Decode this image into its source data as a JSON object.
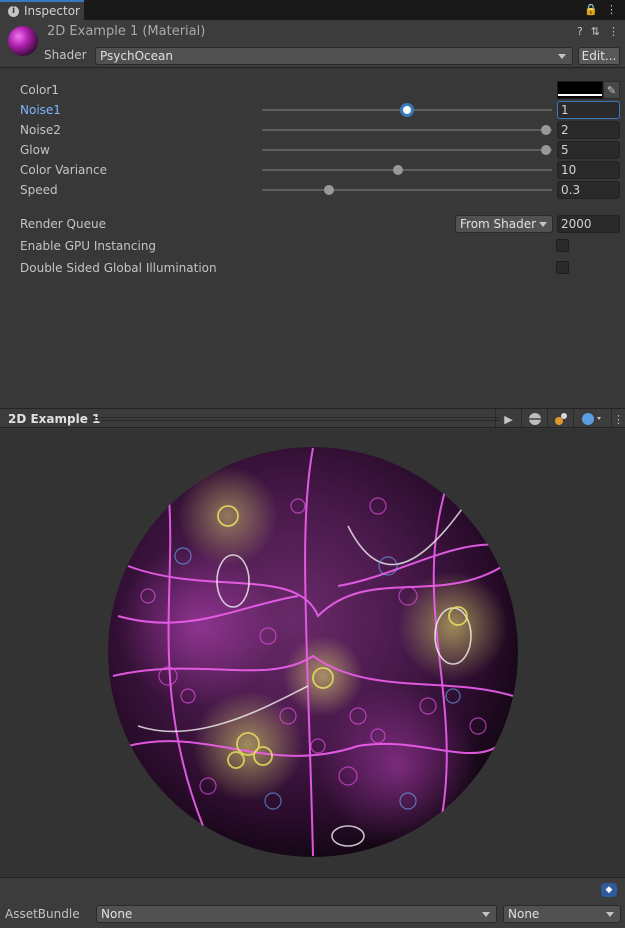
{
  "tab": {
    "label": "Inspector",
    "icon": "info-icon"
  },
  "header": {
    "title": "2D Example 1 (Material)",
    "shader_label": "Shader",
    "shader_value": "PsychOcean",
    "edit_label": "Edit..."
  },
  "properties": {
    "color1": {
      "label": "Color1",
      "color": "#000000"
    },
    "sliders": [
      {
        "label": "Noise1",
        "value": "1",
        "fraction": 0.5,
        "active": true
      },
      {
        "label": "Noise2",
        "value": "2",
        "fraction": 0.98,
        "active": false
      },
      {
        "label": "Glow",
        "value": "5",
        "fraction": 0.98,
        "active": false
      },
      {
        "label": "Color Variance",
        "value": "10",
        "fraction": 0.47,
        "active": false
      },
      {
        "label": "Speed",
        "value": "0.3",
        "fraction": 0.23,
        "active": false
      }
    ],
    "render_queue": {
      "label": "Render Queue",
      "mode": "From Shader",
      "value": "2000"
    },
    "gpu_instancing": {
      "label": "Enable GPU Instancing",
      "checked": false
    },
    "double_sided_gi": {
      "label": "Double Sided Global Illumination",
      "checked": false
    }
  },
  "preview": {
    "title": "2D Example 1"
  },
  "footer": {
    "assetbundle_label": "AssetBundle",
    "bundle_value": "None",
    "variant_value": "None"
  },
  "colors": {
    "accent": "#3a79bb",
    "panel": "#383838",
    "sphere_magenta": "#e040e0",
    "sphere_yellow": "#e8e060"
  }
}
